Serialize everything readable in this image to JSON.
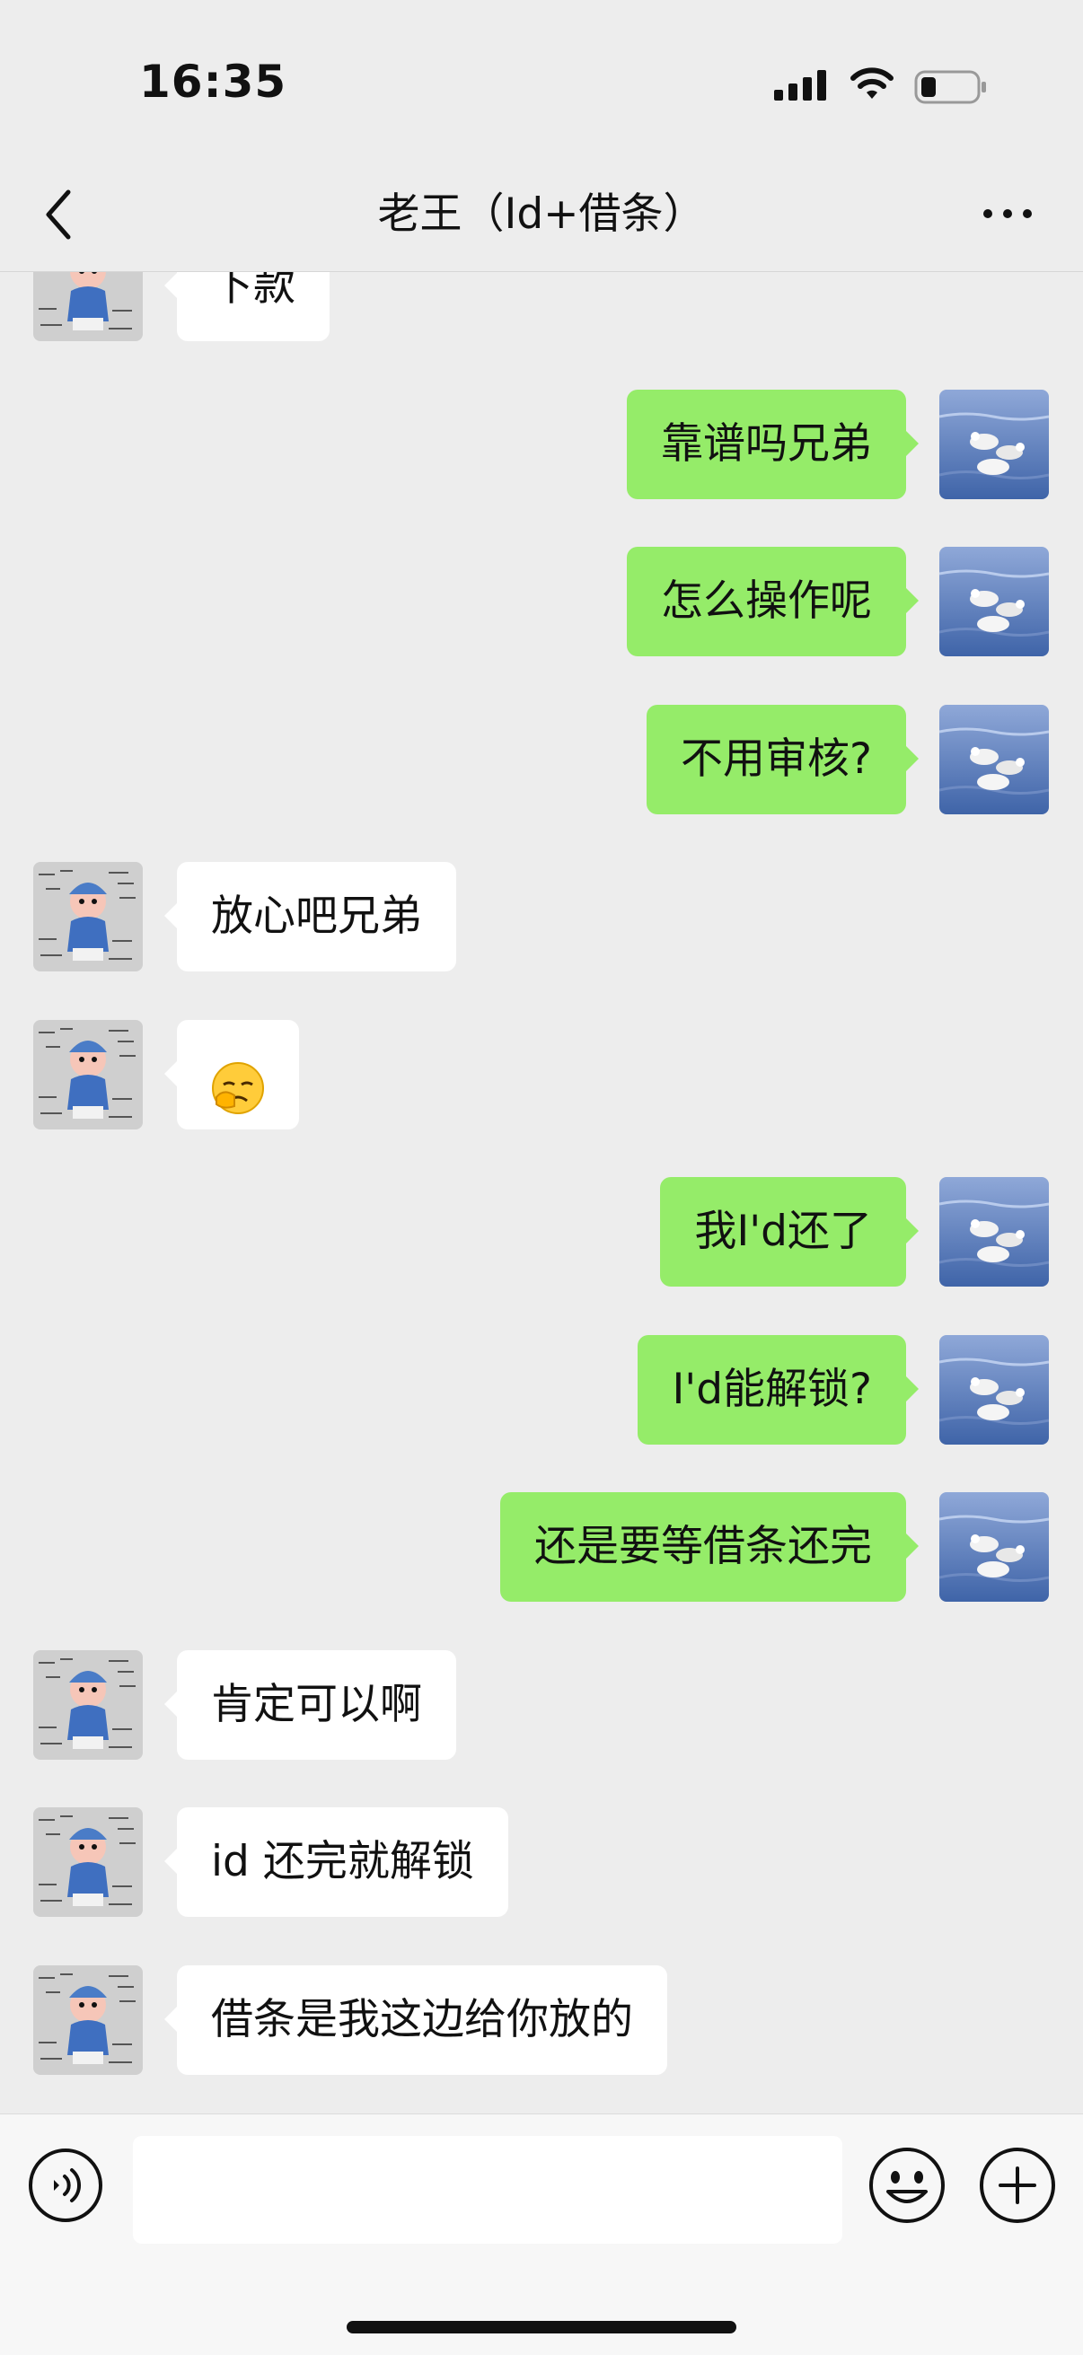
{
  "status_bar": {
    "time": "16:35",
    "icons": [
      "signal-icon",
      "wifi-icon",
      "battery-icon"
    ]
  },
  "nav": {
    "title": "老王（Id+借条）",
    "back_icon": "chevron-left-icon",
    "more_icon": "more-icon"
  },
  "colors": {
    "background": "#ededed",
    "sent_bubble": "#95ec69",
    "received_bubble": "#ffffff"
  },
  "messages": [
    {
      "side": "left",
      "text": "下款"
    },
    {
      "side": "right",
      "text": "靠谱吗兄弟"
    },
    {
      "side": "right",
      "text": "怎么操作呢"
    },
    {
      "side": "right",
      "text": "不用审核?"
    },
    {
      "side": "left",
      "text": "放心吧兄弟"
    },
    {
      "side": "left",
      "text": "",
      "emoji": "face-palm-emoji"
    },
    {
      "side": "right",
      "text": "我I'd还了"
    },
    {
      "side": "right",
      "text": "I'd能解锁?"
    },
    {
      "side": "right",
      "text": "还是要等借条还完"
    },
    {
      "side": "left",
      "text": "肯定可以啊"
    },
    {
      "side": "left",
      "text": "id 还完就解锁"
    },
    {
      "side": "left",
      "text": "借条是我这边给你放的"
    }
  ],
  "input_bar": {
    "value": "",
    "placeholder": "",
    "icons": [
      "voice-icon",
      "emoji-icon",
      "plus-icon"
    ]
  }
}
